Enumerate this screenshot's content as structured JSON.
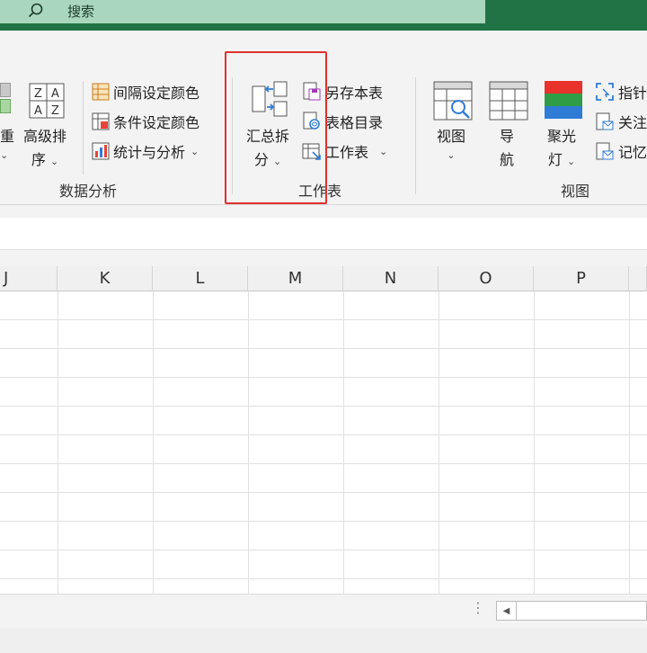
{
  "search": {
    "text": "搜索"
  },
  "ribbon": {
    "dedupe_partial": "重",
    "advanced_sort": {
      "line1": "高级排",
      "line2": "序"
    },
    "interval_color": "间隔设定颜色",
    "condition_color": "条件设定颜色",
    "stats_analysis": "统计与分析",
    "group_data_analysis": "数据分析",
    "summary_split": {
      "line1": "汇总拆",
      "line2": "分"
    },
    "save_sheet": "另存本表",
    "table_toc": "表格目录",
    "worksheet": "工作表",
    "group_worksheet": "工作表",
    "view": "视图",
    "nav": {
      "line1": "导",
      "line2": "航"
    },
    "spotlight": {
      "line1": "聚光",
      "line2": "灯"
    },
    "pointer_partial": "指针",
    "follow_partial": "关注",
    "memory_partial": "记忆",
    "group_view": "视图"
  },
  "columns": [
    "J",
    "K",
    "L",
    "M",
    "N",
    "O",
    "P"
  ],
  "colors": {
    "accent": "#217346",
    "highlight": "#e0312d"
  }
}
